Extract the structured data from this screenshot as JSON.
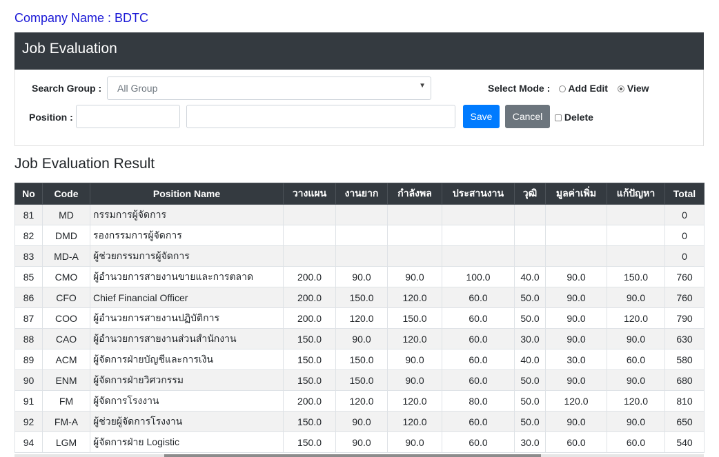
{
  "company_label": "Company Name : BDTC",
  "card_title": "Job Evaluation",
  "search": {
    "group_label": "Search Group :",
    "group_value": "All Group",
    "position_label": "Position :",
    "position_code_value": "",
    "position_name_value": ""
  },
  "mode": {
    "label": "Select Mode :",
    "options": [
      {
        "label": "Add Edit",
        "selected": false
      },
      {
        "label": "View",
        "selected": true
      }
    ]
  },
  "buttons": {
    "save": "Save",
    "cancel": "Cancel",
    "delete_label": "Delete"
  },
  "result_title": "Job Evaluation Result",
  "table": {
    "headers": [
      "No",
      "Code",
      "Position Name",
      "วางแผน",
      "งานยาก",
      "กำลังพล",
      "ประสานงาน",
      "วุฒิ",
      "มูลค่าเพิ่ม",
      "แก้ปัญหา",
      "Total"
    ],
    "rows": [
      [
        "81",
        "MD",
        "กรรมการผู้จัดการ",
        "",
        "",
        "",
        "",
        "",
        "",
        "",
        "0"
      ],
      [
        "82",
        "DMD",
        "รองกรรมการผู้จัดการ",
        "",
        "",
        "",
        "",
        "",
        "",
        "",
        "0"
      ],
      [
        "83",
        "MD-A",
        "ผู้ช่วยกรรมการผู้จัดการ",
        "",
        "",
        "",
        "",
        "",
        "",
        "",
        "0"
      ],
      [
        "85",
        "CMO",
        "ผู้อำนวยการสายงานขายและการตลาด",
        "200.0",
        "90.0",
        "90.0",
        "100.0",
        "40.0",
        "90.0",
        "150.0",
        "760"
      ],
      [
        "86",
        "CFO",
        "Chief Financial Officer",
        "200.0",
        "150.0",
        "120.0",
        "60.0",
        "50.0",
        "90.0",
        "90.0",
        "760"
      ],
      [
        "87",
        "COO",
        "ผู้อำนวยการสายงานปฏิบัติการ",
        "200.0",
        "120.0",
        "150.0",
        "60.0",
        "50.0",
        "90.0",
        "120.0",
        "790"
      ],
      [
        "88",
        "CAO",
        "ผู้อำนวยการสายงานส่วนสำนักงาน",
        "150.0",
        "90.0",
        "120.0",
        "60.0",
        "30.0",
        "90.0",
        "90.0",
        "630"
      ],
      [
        "89",
        "ACM",
        "ผู้จัดการฝ่ายบัญชีและการเงิน",
        "150.0",
        "150.0",
        "90.0",
        "60.0",
        "40.0",
        "30.0",
        "60.0",
        "580"
      ],
      [
        "90",
        "ENM",
        "ผู้จัดการฝ่ายวิศวกรรม",
        "150.0",
        "150.0",
        "90.0",
        "60.0",
        "50.0",
        "90.0",
        "90.0",
        "680"
      ],
      [
        "91",
        "FM",
        "ผู้จัดการโรงงาน",
        "200.0",
        "120.0",
        "120.0",
        "80.0",
        "50.0",
        "120.0",
        "120.0",
        "810"
      ],
      [
        "92",
        "FM-A",
        "ผู้ช่วยผู้จัดการโรงงาน",
        "150.0",
        "90.0",
        "120.0",
        "60.0",
        "50.0",
        "90.0",
        "90.0",
        "650"
      ],
      [
        "94",
        "LGM",
        "ผู้จัดการฝ่าย Logistic",
        "150.0",
        "90.0",
        "90.0",
        "60.0",
        "30.0",
        "60.0",
        "60.0",
        "540"
      ]
    ]
  }
}
